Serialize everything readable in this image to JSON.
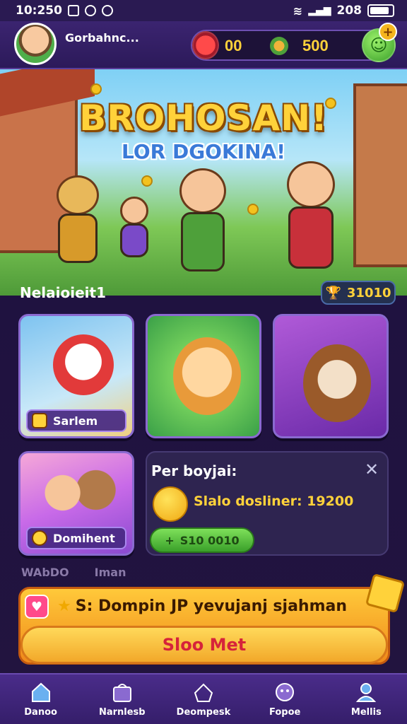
{
  "status_bar": {
    "time": "10:250",
    "right_text": "208"
  },
  "header": {
    "player_name": "Gorbahnc...",
    "currency_a": "00",
    "currency_b": "500",
    "plus": "+"
  },
  "banner": {
    "title": "BROHOSAN!",
    "subtitle": "LOR DGOKINA!"
  },
  "section": {
    "title": "Nelaioieit1",
    "count": "31010",
    "count_icon": "trophy-icon"
  },
  "cards": [
    {
      "label": "Sarlem"
    },
    {
      "label": ""
    },
    {
      "label": ""
    },
    {
      "label": "Domihent"
    }
  ],
  "info_panel": {
    "title": "Per boyjai:",
    "line": "Slalo dosliner: 19200",
    "button": "S10 0010"
  },
  "sub_row": [
    "WAbDO",
    "Iman"
  ],
  "promo": {
    "text": "S: Dompin JP yevujanj sjahman",
    "button": "Sloo Met"
  },
  "nav": [
    {
      "label": "Danoo",
      "icon": "home-icon"
    },
    {
      "label": "Narnlesb",
      "icon": "shop-icon"
    },
    {
      "label": "Deompesk",
      "icon": "house-icon"
    },
    {
      "label": "Fopoe",
      "icon": "game-icon"
    },
    {
      "label": "Mellis",
      "icon": "profile-icon"
    }
  ],
  "colors": {
    "accent": "#ffd23a",
    "bg": "#2a1650",
    "promo": "#f08a1a",
    "green": "#3aa02a"
  }
}
